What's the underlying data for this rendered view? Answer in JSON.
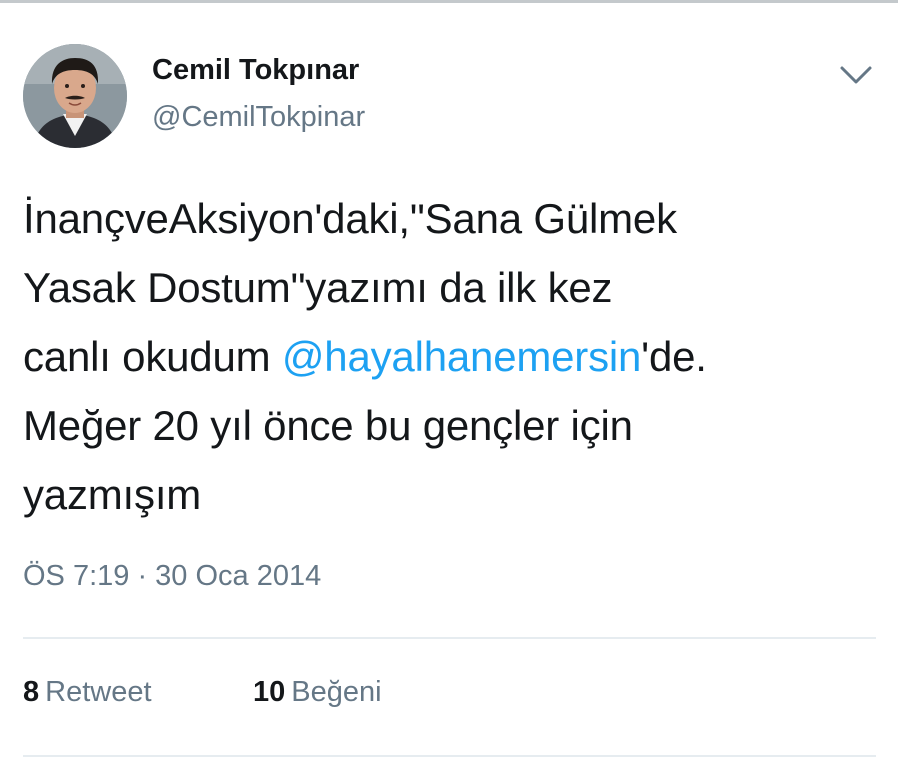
{
  "tweet": {
    "author": {
      "display_name": "Cemil Tokpınar",
      "username": "@CemilTokpinar",
      "avatar_icon": "profile-photo"
    },
    "menu_icon": "chevron-down-icon",
    "text_lines": [
      "İnançveAksiyon'daki,\"Sana Gülmek",
      "Yasak Dostum\"yazımı da ilk kez",
      "canlı okudum ",
      "Meğer 20 yıl önce bu gençler için",
      "yazmışım"
    ],
    "mention": "@hayalhanemersin",
    "mention_suffix": "'de.",
    "timestamp": "ÖS 7:19 · 30 Oca 2014",
    "stats": {
      "retweet_count": "8",
      "retweet_label": "Retweet",
      "like_count": "10",
      "like_label": "Beğeni"
    }
  },
  "colors": {
    "text": "#14171a",
    "secondary": "#657786",
    "link": "#1da1f2",
    "divider": "#e6ecf0"
  }
}
